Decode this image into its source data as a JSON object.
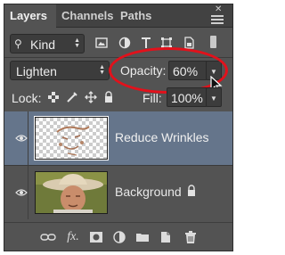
{
  "tabs": [
    {
      "label": "Layers"
    },
    {
      "label": "Channels"
    },
    {
      "label": "Paths"
    }
  ],
  "window": {
    "close_glyph": "✕",
    "menu_icon": "panel-menu-icon"
  },
  "filter": {
    "kind_label": "Kind",
    "search_icon": "search-icon"
  },
  "blend": {
    "mode": "Lighten"
  },
  "opacity": {
    "label": "Opacity:",
    "value": "60%"
  },
  "lock": {
    "label": "Lock:"
  },
  "fill": {
    "label": "Fill:",
    "value": "100%"
  },
  "layers": [
    {
      "name": "Reduce Wrinkles",
      "selected": true,
      "visible": true,
      "locked": false
    },
    {
      "name": "Background",
      "selected": false,
      "visible": true,
      "locked": true
    }
  ],
  "toolbar": {
    "fx_label": "fx."
  },
  "colors": {
    "panel_bg": "#535353",
    "tabbar_bg": "#424242",
    "selected_row": "#65758b",
    "highlight_oval": "#e2111b"
  }
}
